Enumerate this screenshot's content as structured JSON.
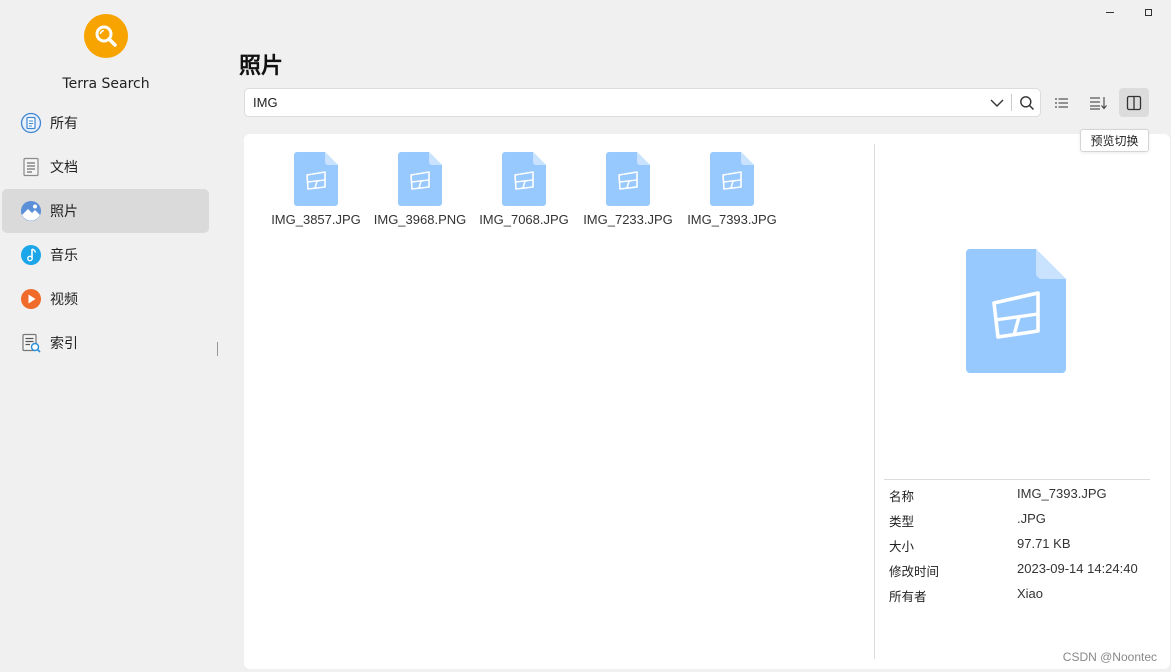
{
  "window": {
    "minimize_icon": "minimize-icon",
    "maximize_icon": "maximize-icon"
  },
  "app": {
    "name": "Terra Search",
    "logo_icon": "search-icon",
    "accent": "#f7a400"
  },
  "sidebar": {
    "items": [
      {
        "label": "所有",
        "icon": "all-files-icon",
        "active": false
      },
      {
        "label": "文档",
        "icon": "document-icon",
        "active": false
      },
      {
        "label": "照片",
        "icon": "photo-icon",
        "active": true
      },
      {
        "label": "音乐",
        "icon": "music-icon",
        "active": false
      },
      {
        "label": "视频",
        "icon": "video-icon",
        "active": false
      },
      {
        "label": "索引",
        "icon": "index-icon",
        "active": false
      }
    ]
  },
  "main": {
    "title": "照片",
    "search": {
      "value": "IMG"
    },
    "tooltip": "预览切换"
  },
  "files": [
    {
      "name": "IMG_3857.JPG"
    },
    {
      "name": "IMG_3968.PNG"
    },
    {
      "name": "IMG_7068.JPG"
    },
    {
      "name": "IMG_7233.JPG"
    },
    {
      "name": "IMG_7393.JPG"
    }
  ],
  "preview": {
    "details": [
      {
        "label": "名称",
        "value": "IMG_7393.JPG"
      },
      {
        "label": "类型",
        "value": ".JPG"
      },
      {
        "label": "大小",
        "value": "97.71 KB"
      },
      {
        "label": "修改时间",
        "value": "2023-09-14 14:24:40"
      },
      {
        "label": "所有者",
        "value": "Xiao"
      }
    ]
  },
  "watermark": "CSDN @Noontec"
}
